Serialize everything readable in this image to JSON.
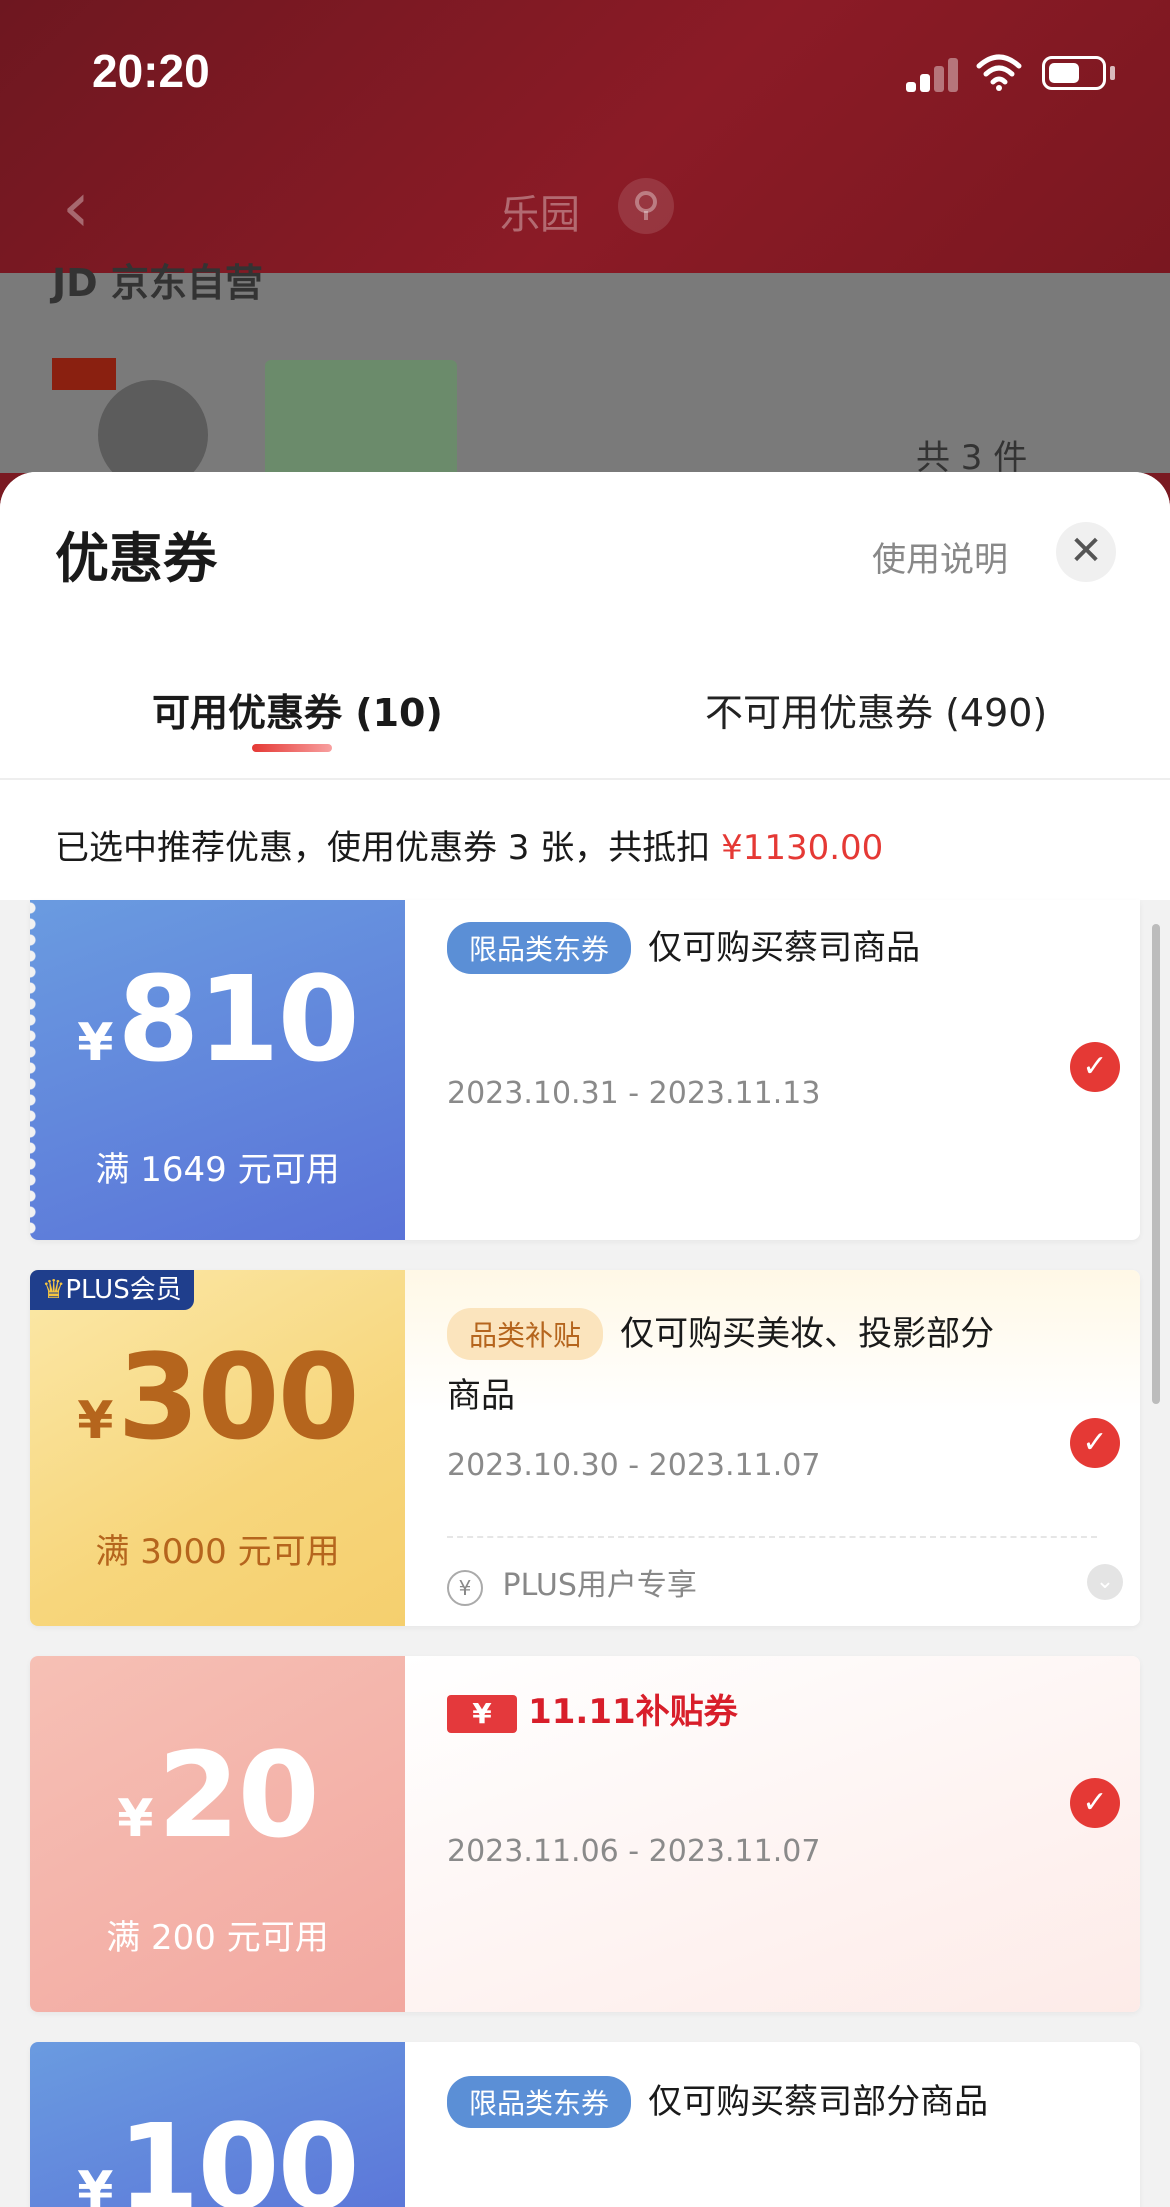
{
  "status_bar": {
    "time": "20:20"
  },
  "nav": {
    "title": "乐园",
    "back_icon": "chevron-left-icon"
  },
  "background": {
    "store": "JD 京东自营",
    "item_count": "共 3 件"
  },
  "sheet": {
    "title": "优惠券",
    "help": "使用说明",
    "tabs": [
      {
        "label": "可用优惠券 (10)",
        "active": true
      },
      {
        "label": "不可用优惠券 (490)",
        "active": false
      }
    ],
    "summary_prefix": "已选中推荐优惠，使用优惠券 3 张，共抵扣 ",
    "summary_amount": "¥1130.00"
  },
  "coupons": [
    {
      "yen": "¥",
      "value": "810",
      "condition": "满 1649 元可用",
      "tag": "限品类东券",
      "title": "仅可购买蔡司商品",
      "dates": "2023.10.31 - 2023.11.13",
      "selected": true
    },
    {
      "badge": "PLUS会员",
      "yen": "¥",
      "value": "300",
      "condition": "满 3000 元可用",
      "tag": "品类补贴",
      "title_line1": "仅可购买美妆、投影部分",
      "title_line2": "商品",
      "dates": "2023.10.30 - 2023.11.07",
      "footer": "PLUS用户专享",
      "selected": true
    },
    {
      "yen": "¥",
      "value": "20",
      "condition": "满 200 元可用",
      "brand_icon": "¥",
      "brand": "11.11补贴券",
      "dates": "2023.11.06 - 2023.11.07",
      "selected": true
    },
    {
      "yen": "¥",
      "value": "100",
      "tag": "限品类东券",
      "title": "仅可购买蔡司部分商品"
    }
  ],
  "colors": {
    "accent_red": "#e53935",
    "tag_blue": "#5b8fd6",
    "plus_gold": "#b5651d"
  }
}
